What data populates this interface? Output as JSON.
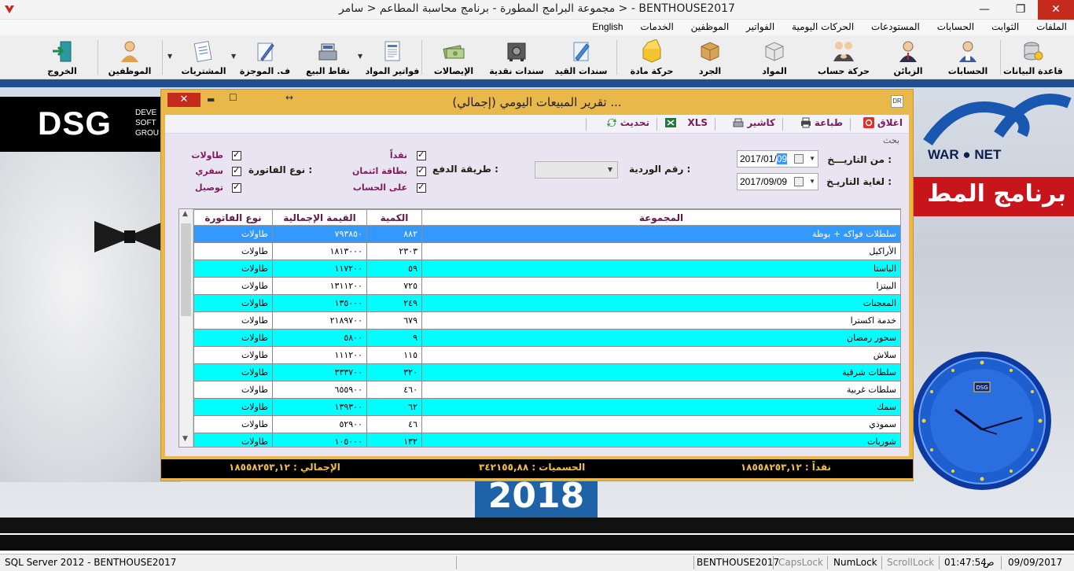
{
  "window": {
    "title": "مجموعة البرامج المطورة - برنامج محاسبة المطاعم < سامر > - BENTHOUSE2017",
    "min": "—",
    "max": "❐",
    "close": "✕"
  },
  "menu": [
    "الملفات",
    "الثوابت",
    "الحسابات",
    "المستودعات",
    "الحركات اليومية",
    "الفواتير",
    "الموظفين",
    "الخدمات",
    "English"
  ],
  "toolbar": {
    "database": "قاعدة البيانات",
    "accounts": "الحسابات",
    "customers": "الزبائن",
    "account_movement": "حركة حساب",
    "materials": "المواد",
    "inventory": "الجرد",
    "material_movement": "حركة مادة",
    "journal_vouchers": "سندات القيد",
    "cash_vouchers": "سندات نقدية",
    "receipts": "الإيصالات",
    "material_invoices": "فواتير المواد",
    "sale_points": "نقاط البيع",
    "summary_invoices": "ف. الموجزة",
    "purchases": "المشتريات",
    "employees": "الموظفين",
    "exit": "الخروج"
  },
  "desktop": {
    "logo_big": "DSG",
    "logo_small": [
      "DEVE",
      "SOFT",
      "GROU"
    ],
    "tagline": "WAR ● NET",
    "program_banner": "برنامج المط",
    "year": "2018",
    "clock_badge": "DSG"
  },
  "dialog": {
    "title": "تقرير المبيعات اليومي (إجمالي) ...",
    "icon": "DR",
    "close": "✕",
    "min": "▬",
    "max": "☐",
    "resize": "↔",
    "toolbar": {
      "close": "اغلاق",
      "print": "طباعة",
      "cashier": "كاشير",
      "xls": "XLS",
      "refresh": "تحديث"
    },
    "search_label": "بحث",
    "from_date_label": "من التاريـــخ :",
    "from_date_prefix": "2017/01/",
    "from_date_sel": "09",
    "to_date_label": "لغاية التاريـخ :",
    "to_date": "2017/09/09",
    "shift_label": "رقم الوردية :",
    "payment_label": "طريقة الدفع :",
    "payment": [
      "نقداً",
      "بطاقة ائتمان",
      "على الحساب"
    ],
    "invoice_type_label": "نوع الفاتورة :",
    "invoice_types": [
      "طاولات",
      "سفري",
      "توصيل"
    ],
    "columns": [
      "المجموعة",
      "الكمية",
      "القيمة الإجمالية",
      "نوع الفاتورة"
    ],
    "rows": [
      [
        "سلطلات فواكه + بوظة",
        "٨٨٢",
        "٧٩٣٨٥٠",
        "طاولات"
      ],
      [
        "الأراكيل",
        "٢٣٠٣",
        "١٨١٣٠٠٠",
        "طاولات"
      ],
      [
        "الباستا",
        "٥٩",
        "١١٧٢٠٠",
        "طاولات"
      ],
      [
        "البيتزا",
        "٧٢٥",
        "١٣١١٢٠٠",
        "طاولات"
      ],
      [
        "المعجنات",
        "٢٤٩",
        "١٣٥٠٠٠",
        "طاولات"
      ],
      [
        "خدمة اكسترا",
        "٦٧٩",
        "٢١٨٩٧٠٠",
        "طاولات"
      ],
      [
        "سحور رمضان",
        "٩",
        "٥٨٠٠",
        "طاولات"
      ],
      [
        "سلاش",
        "١١٥",
        "١١١٢٠٠",
        "طاولات"
      ],
      [
        "سلطات شرقية",
        "٣٢٠",
        "٣٣٣٧٠٠",
        "طاولات"
      ],
      [
        "سلطات غربية",
        "٤٦٠",
        "٦٥٥٩٠٠",
        "طاولات"
      ],
      [
        "سمك",
        "٦٢",
        "١٣٩٣٠٠",
        "طاولات"
      ],
      [
        "سموذي",
        "٤٦",
        "٥٢٩٠٠",
        "طاولات"
      ],
      [
        "شوربات",
        "١٣٢",
        "١٠٥٠٠٠",
        "طاولات"
      ]
    ],
    "totals": {
      "cash": "نقداً : ١٨٥٥٨٢٥٣,١٢",
      "discounts": "الحسميات : ٣٤٢١٥٥,٨٨",
      "total": "الإجمالي : ١٨٥٥٨٢٥٣,١٢"
    }
  },
  "status": {
    "server": "SQL Server 2012 - BENTHOUSE2017",
    "db": "BENTHOUSE2017",
    "caps": "CapsLock",
    "num": "NumLock",
    "scroll": "ScrollLock",
    "time": "01:47:54",
    "ampm": "ص",
    "date": "09/09/2017"
  },
  "colors": {
    "dialog_frame": "#e8b84a",
    "row_cyan": "#00ffff",
    "row_selected": "#3399ff",
    "accent_text": "#7d1c5c",
    "totals_text": "#f0c040"
  }
}
